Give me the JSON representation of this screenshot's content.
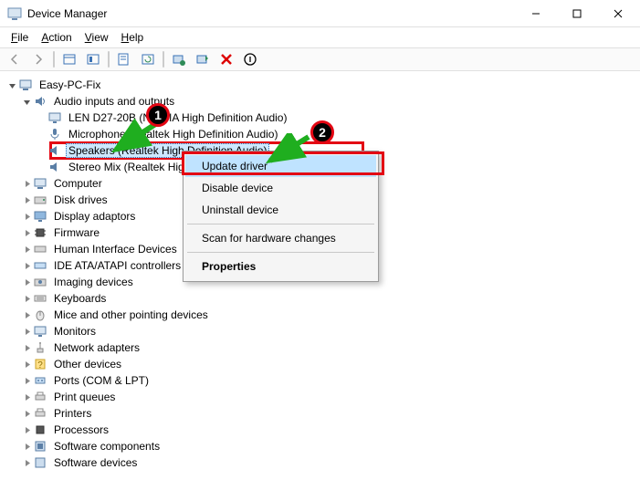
{
  "window": {
    "title": "Device Manager"
  },
  "menu": {
    "file": "File",
    "action": "Action",
    "view": "View",
    "help": "Help"
  },
  "tree": {
    "root": "Easy-PC-Fix",
    "audio_cat": "Audio inputs and outputs",
    "audio": {
      "lenovo": "LEN D27-20B (NVIDIA High Definition Audio)",
      "mic": "Microphone (Realtek High Definition Audio)",
      "speakers": "Speakers (Realtek High Definition Audio)",
      "stereomix": "Stereo Mix (Realtek High Definition Audio)"
    },
    "categories": {
      "computer": "Computer",
      "disk": "Disk drives",
      "display": "Display adaptors",
      "firmware": "Firmware",
      "hid": "Human Interface Devices",
      "ide": "IDE ATA/ATAPI controllers",
      "imaging": "Imaging devices",
      "keyboards": "Keyboards",
      "mice": "Mice and other pointing devices",
      "monitors": "Monitors",
      "network": "Network adapters",
      "other": "Other devices",
      "ports": "Ports (COM & LPT)",
      "printq": "Print queues",
      "printers": "Printers",
      "processors": "Processors",
      "swcomp": "Software components",
      "swdev": "Software devices"
    }
  },
  "context_menu": {
    "update": "Update driver",
    "disable": "Disable device",
    "uninstall": "Uninstall device",
    "scan": "Scan for hardware changes",
    "properties": "Properties"
  },
  "annotations": {
    "badge1": "1",
    "badge2": "2"
  }
}
